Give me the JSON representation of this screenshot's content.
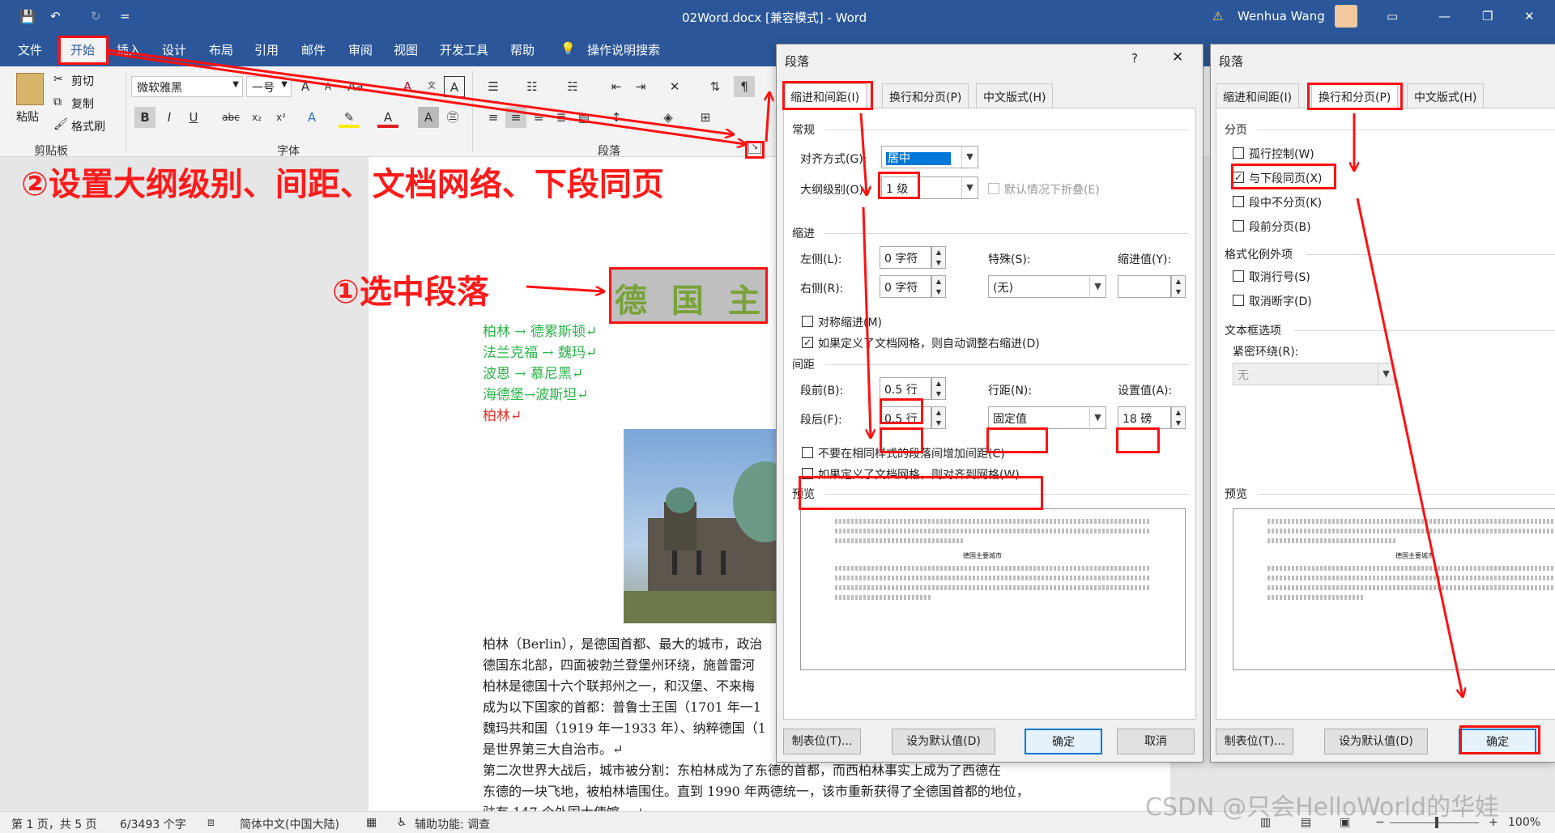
{
  "window": {
    "title": "02Word.docx [兼容模式] - Word",
    "user": "Wenhua Wang",
    "qat_more": "="
  },
  "menu": [
    "文件",
    "开始",
    "插入",
    "设计",
    "布局",
    "引用",
    "邮件",
    "审阅",
    "视图",
    "开发工具",
    "帮助",
    "操作说明搜索"
  ],
  "ribbon": {
    "paste": "粘贴",
    "cut": "剪切",
    "copy": "复制",
    "format_painter": "格式刷",
    "font_name": "微软雅黑",
    "font_size": "一号",
    "groups": {
      "clipboard": "剪贴板",
      "font": "字体",
      "paragraph": "段落"
    }
  },
  "annotations": {
    "step2": "②设置大纲级别、间距、文档网络、下段同页",
    "step1": "①选中段落"
  },
  "document": {
    "heading": "德 国 主 要",
    "lines": [
      {
        "text": "柏林 → 德累斯顿↵",
        "color": "green"
      },
      {
        "text": "法兰克福 → 魏玛↵",
        "color": "green"
      },
      {
        "text": "波恩 → 慕尼黑↵",
        "color": "green"
      },
      {
        "text": "海德堡→波斯坦↵",
        "color": "green"
      },
      {
        "text": "柏林↵",
        "color": "red"
      }
    ],
    "body": [
      "柏林（Berlin），是德国首都、最大的城市，政治",
      "德国东北部，四面被勃兰登堡州环绕，施普雷河",
      "柏林是德国十六个联邦州之一，和汉堡、不来梅",
      "成为以下国家的首都：普鲁士王国（1701 年一1",
      "魏玛共和国（1919 年一1933 年）、纳粹德国（1",
      "是世界第三大自治市。↵",
      "第二次世界大战后，城市被分割：东柏林成为了东德的首都，而西柏林事实上成为了西德在",
      "东德的一块飞地，被柏林墙围住。直到 1990 年两德统一，该市重新获得了全德国首都的地位，",
      "驻有 147 个外国大使馆。↵"
    ]
  },
  "status": {
    "page": "第 1 页，共 5 页",
    "words": "6/3493 个字",
    "lang": "简体中文(中国大陆)",
    "accessibility": "辅助功能: 调查",
    "zoom": "100%",
    "watermark": "CSDN @只会HelloWorld的华娃"
  },
  "dialog1": {
    "title": "段落",
    "help": "?",
    "tabs": [
      "缩进和间距(I)",
      "换行和分页(P)",
      "中文版式(H)"
    ],
    "general": "常规",
    "align_label": "对齐方式(G):",
    "align_value": "居中",
    "outline_label": "大纲级别(O):",
    "outline_value": "1 级",
    "collapse": "默认情况下折叠(E)",
    "indent": "缩进",
    "left_label": "左侧(L):",
    "left_value": "0 字符",
    "right_label": "右侧(R):",
    "right_value": "0 字符",
    "special_label": "特殊(S):",
    "special_value": "(无)",
    "indent_by_label": "缩进值(Y):",
    "mirror": "对称缩进(M)",
    "auto_adjust": "如果定义了文档网格，则自动调整右缩进(D)",
    "spacing": "间距",
    "before_label": "段前(B):",
    "before_value": "0.5 行",
    "after_label": "段后(F):",
    "after_value": "0.5 行",
    "line_label": "行距(N):",
    "line_value": "固定值",
    "at_label": "设置值(A):",
    "at_value": "18 磅",
    "no_space": "不要在相同样式的段落间增加间距(C)",
    "snap": "如果定义了文档网格，则对齐到网格(W)",
    "preview": "预览",
    "preview_center": "德国主要城市",
    "tabs_btn": "制表位(T)...",
    "default_btn": "设为默认值(D)",
    "ok": "确定",
    "cancel": "取消"
  },
  "dialog2": {
    "title": "段落",
    "tabs": [
      "缩进和间距(I)",
      "换行和分页(P)",
      "中文版式(H)"
    ],
    "pagination": "分页",
    "widow": "孤行控制(W)",
    "keep_next": "与下段同页(X)",
    "keep_lines": "段中不分页(K)",
    "page_before": "段前分页(B)",
    "exceptions": "格式化例外项",
    "suppress_ln": "取消行号(S)",
    "no_hyphen": "取消断字(D)",
    "textbox": "文本框选项",
    "tight_wrap": "紧密环绕(R):",
    "tight_value": "无",
    "preview": "预览",
    "preview_center": "德国主要城市",
    "tabs_btn": "制表位(T)...",
    "default_btn": "设为默认值(D)",
    "ok": "确定"
  }
}
